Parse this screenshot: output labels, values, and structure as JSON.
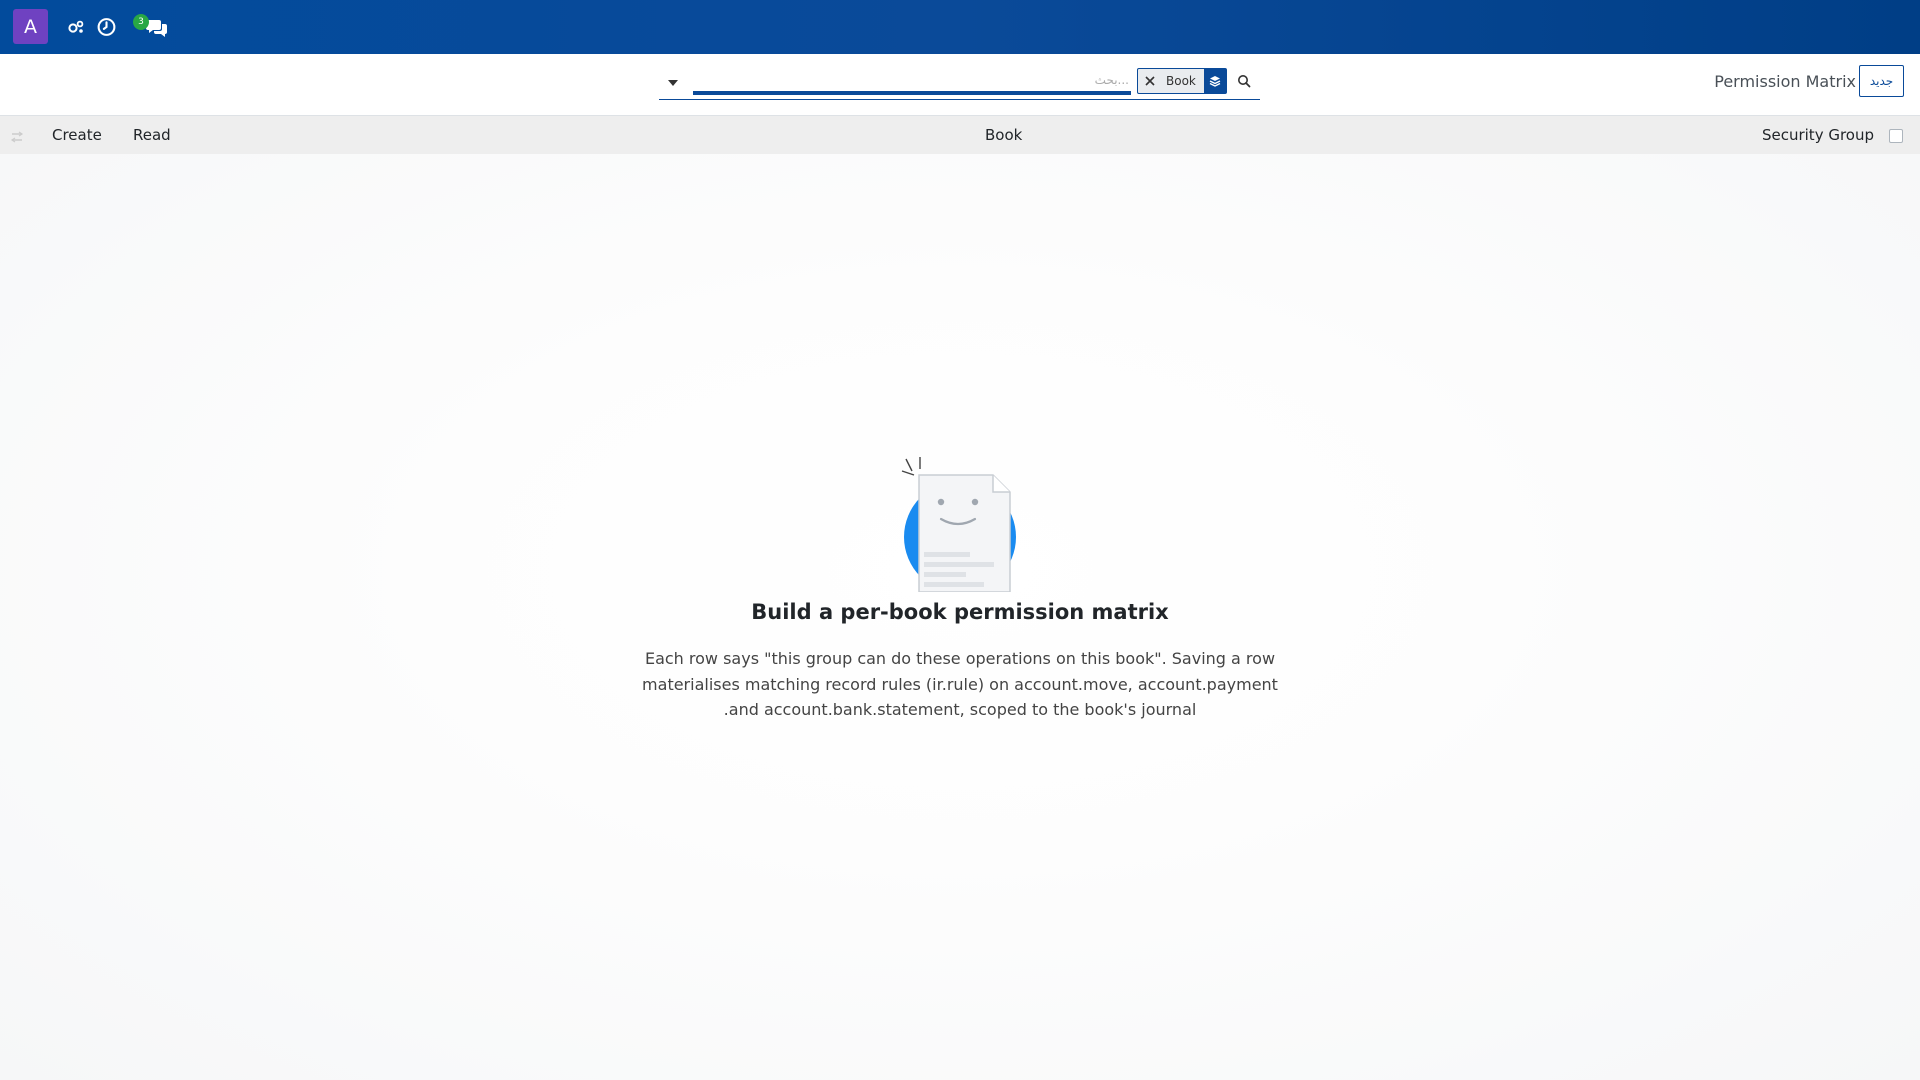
{
  "navbar": {
    "avatar_letter": "A",
    "icons": [
      "activity-icon",
      "clock-icon",
      "chat-icon"
    ],
    "messages_count": "3"
  },
  "control_panel": {
    "new_button_label": "جديد",
    "breadcrumb": "Permission Matrix",
    "search": {
      "placeholder": "بحث...",
      "facet_value": "Book"
    }
  },
  "list_header": {
    "columns": [
      "Security Group",
      "Book",
      "Read",
      "Create"
    ]
  },
  "empty_state": {
    "title": "Build a per-book permission matrix",
    "body_lines": [
      "Each row says \"this group can do these operations on this book\". Saving a row",
      "materialises matching record rules (ir.rule) on account.move, account.payment",
      ".and account.bank.statement, scoped to the book's journal"
    ]
  },
  "colors": {
    "navbar": "#0a4a99",
    "avatar": "#6f42c1",
    "badge": "#28a745",
    "illustration": "#1a8bf0"
  }
}
